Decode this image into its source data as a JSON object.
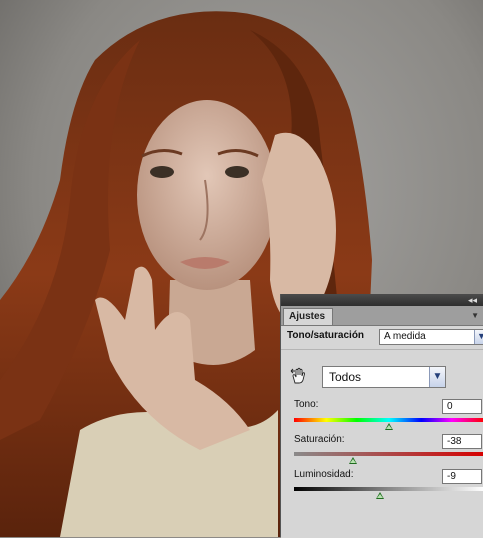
{
  "panel": {
    "tab_label": "Ajustes",
    "adjustment_title": "Tono/saturación",
    "preset_value": "A medida",
    "channel_value": "Todos"
  },
  "sliders": [
    {
      "label": "Tono:",
      "value": "0",
      "fraction": 0.5
    },
    {
      "label": "Saturación:",
      "value": "-38",
      "fraction": 0.31
    },
    {
      "label": "Luminosidad:",
      "value": "-9",
      "fraction": 0.455
    }
  ],
  "icons": {
    "collapse": "double-chevron-right-icon",
    "panel_menu": "panel-menu-icon",
    "target_adjustment": "hand-scrubby-icon",
    "dropdown": "chevron-down-icon"
  },
  "colors": {
    "panel_bg": "#d6d6d6",
    "thumb": "#1e6b1e",
    "dropdown_accent": "#25407a"
  }
}
